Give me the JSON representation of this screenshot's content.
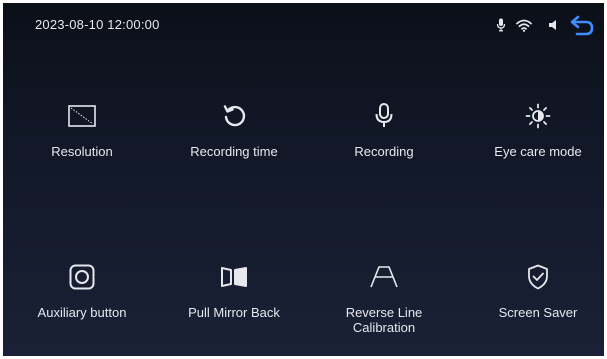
{
  "status": {
    "datetime": "2023-08-10 12:00:00",
    "icons": [
      "microphone-icon",
      "wifi-icon",
      "speaker-icon",
      "back-arrow-icon"
    ]
  },
  "menu": {
    "items": [
      {
        "label": "Resolution",
        "icon": "resolution-icon"
      },
      {
        "label": "Recording time",
        "icon": "recording-time-icon"
      },
      {
        "label": "Recording",
        "icon": "microphone-icon"
      },
      {
        "label": "Eye care mode",
        "icon": "brightness-icon"
      },
      {
        "label": "Auxiliary button",
        "icon": "auxiliary-button-icon"
      },
      {
        "label": "Pull Mirror Back",
        "icon": "mirror-icon"
      },
      {
        "label": "Reverse Line\nCalibration",
        "icon": "reverse-line-icon"
      },
      {
        "label": "Screen Saver",
        "icon": "shield-check-icon"
      }
    ]
  },
  "colors": {
    "accent": "#3f8cff",
    "text": "#e6e8ee",
    "background_top": "#0b0f18",
    "background_bottom": "#1a2136"
  }
}
